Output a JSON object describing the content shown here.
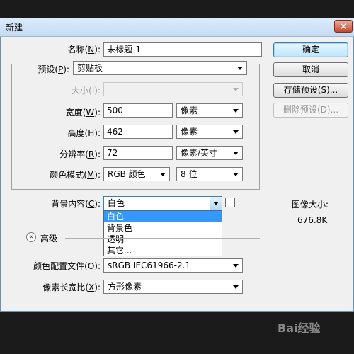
{
  "window": {
    "title": "新建",
    "close_glyph": "×"
  },
  "buttons": {
    "ok": "确定",
    "cancel": "取消",
    "save_preset": "存储预设(S)...",
    "delete_preset": "删除预设(D)..."
  },
  "name": {
    "label_pre": "名称(",
    "label_key": "N",
    "label_post": "):",
    "value": "未标题-1"
  },
  "preset": {
    "label_pre": "预设(",
    "label_key": "P",
    "label_post": "):",
    "value": "剪贴板"
  },
  "size": {
    "label": "大小(I):"
  },
  "width": {
    "label_pre": "宽度(",
    "label_key": "W",
    "label_post": "):",
    "value": "500",
    "unit": "像素"
  },
  "height": {
    "label_pre": "高度(",
    "label_key": "H",
    "label_post": "):",
    "value": "462",
    "unit": "像素"
  },
  "resolution": {
    "label_pre": "分辨率(",
    "label_key": "R",
    "label_post": "):",
    "value": "72",
    "unit": "像素/英寸"
  },
  "color_mode": {
    "label_pre": "颜色模式(",
    "label_key": "M",
    "label_post": "):",
    "value": "RGB 颜色",
    "depth": "8 位"
  },
  "background": {
    "label_pre": "背景内容(",
    "label_key": "C",
    "label_post": "):",
    "value": "白色",
    "options": [
      "白色",
      "背景色",
      "透明",
      "其它..."
    ]
  },
  "advanced": {
    "label": "高级",
    "toggle_glyph": "«"
  },
  "image_size": {
    "label": "图像大小:",
    "value": "676.8K"
  },
  "color_profile": {
    "label_pre": "颜色配置文件(",
    "label_key": "O",
    "label_post": "):",
    "value": "sRGB IEC61966-2.1"
  },
  "pixel_aspect": {
    "label_pre": "像素长宽比(",
    "label_key": "X",
    "label_post": "):",
    "value": "方形像素"
  },
  "watermark": "Bai经验",
  "colors": {
    "selection": "#3399ff",
    "dialog_bg": "#f0f0f0",
    "titlebar": "#c4daf1"
  }
}
